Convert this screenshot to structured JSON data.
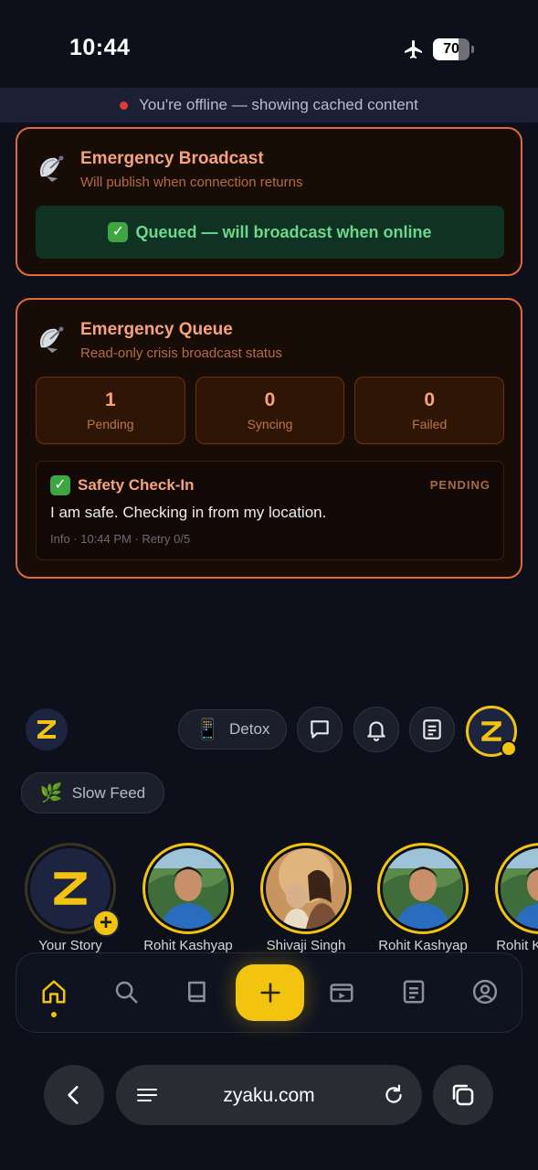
{
  "status_bar": {
    "time": "10:44",
    "battery_level": "70"
  },
  "offline_banner": {
    "text": "You're offline — showing cached content"
  },
  "broadcast_card": {
    "title": "Emergency Broadcast",
    "subtitle": "Will publish when connection returns",
    "queued_text": "Queued — will broadcast when online",
    "check": "✓"
  },
  "queue_card": {
    "title": "Emergency Queue",
    "subtitle": "Read-only crisis broadcast status",
    "stats": [
      {
        "value": "1",
        "label": "Pending"
      },
      {
        "value": "0",
        "label": "Syncing"
      },
      {
        "value": "0",
        "label": "Failed"
      }
    ],
    "item": {
      "check": "✓",
      "title": "Safety Check-In",
      "state": "PENDING",
      "message": "I am safe. Checking in from my location.",
      "meta": "Info · 10:44 PM · Retry 0/5"
    }
  },
  "top_actions": {
    "detox_label": "Detox",
    "detox_icon": "📱"
  },
  "slow_feed": {
    "label": "Slow Feed",
    "icon": "🌿"
  },
  "stories": [
    {
      "name": "Your Story",
      "type": "own"
    },
    {
      "name": "Rohit Kashyap",
      "type": "person-a"
    },
    {
      "name": "Shivaji Singh",
      "type": "person-b"
    },
    {
      "name": "Rohit Kashyap",
      "type": "person-a"
    },
    {
      "name": "Rohit Kashyap",
      "type": "person-a"
    }
  ],
  "browser": {
    "url": "zyaku.com"
  },
  "colors": {
    "accent": "#f2c40f",
    "alert_border": "#e2693a",
    "success": "#6bd88d"
  }
}
